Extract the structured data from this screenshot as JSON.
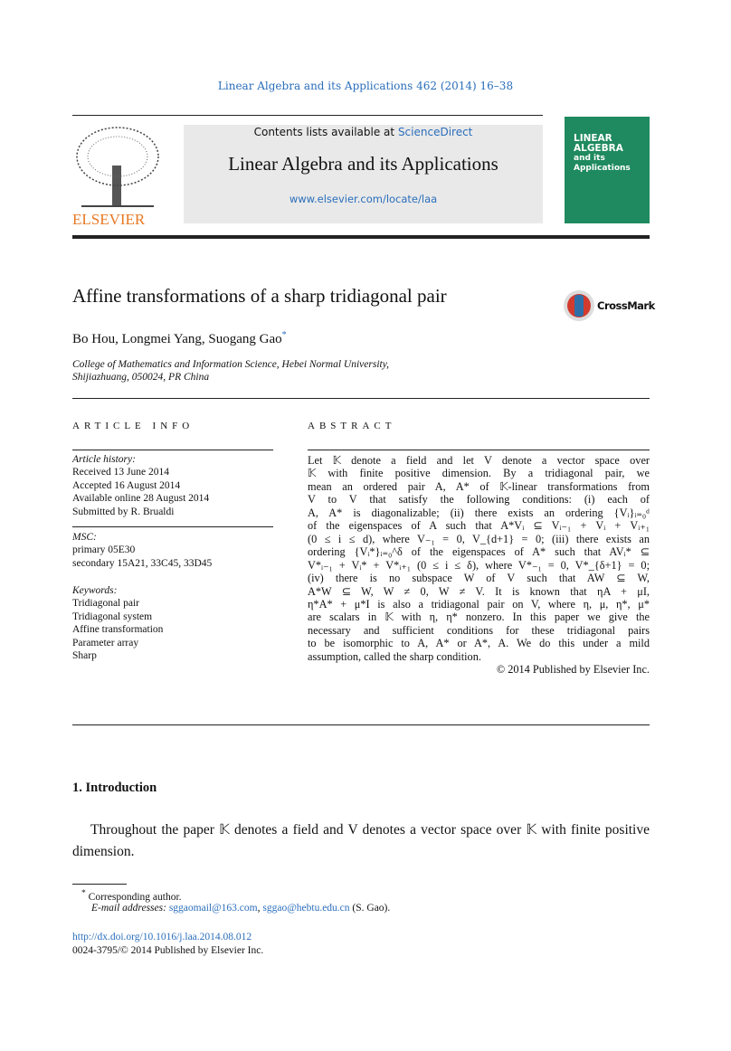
{
  "header": {
    "citation": "Linear Algebra and its Applications 462 (2014) 16–38",
    "contents_prefix": "Contents lists available at ",
    "contents_link": "ScienceDirect",
    "journal_title": "Linear Algebra and its Applications",
    "journal_url": "www.elsevier.com/locate/laa",
    "publisher_logo": "ELSEVIER",
    "cover_title": [
      "LINEAR",
      "ALGEBRA",
      "and its",
      "Applications"
    ]
  },
  "article": {
    "title": "Affine transformations of a sharp tridiagonal pair",
    "crossmark": "CrossMark",
    "authors": "Bo Hou, Longmei Yang, Suogang Gao",
    "author_mark": "*",
    "affiliation": [
      "College of Mathematics and Information Science, Hebei Normal University,",
      "Shijiazhuang, 050024, PR China"
    ]
  },
  "article_info": {
    "heading": "ARTICLE INFO",
    "history_label": "Article history:",
    "history": [
      "Received 13 June 2014",
      "Accepted 16 August 2014",
      "Available online 28 August 2014",
      "Submitted by R. Brualdi"
    ],
    "msc_label": "MSC:",
    "msc": [
      "primary 05E30",
      "secondary 15A21, 33C45, 33D45"
    ],
    "keywords_label": "Keywords:",
    "keywords": [
      "Tridiagonal pair",
      "Tridiagonal system",
      "Affine transformation",
      "Parameter array",
      "Sharp"
    ]
  },
  "abstract": {
    "heading": "ABSTRACT",
    "lines": [
      "Let 𝕂 denote a field and let V denote a vector space over",
      "𝕂 with finite positive dimension. By a tridiagonal pair, we",
      "mean an ordered pair A, A* of 𝕂-linear transformations from",
      "V to V that satisfy the following conditions: (i) each of",
      "A, A* is diagonalizable; (ii) there exists an ordering {Vᵢ}ᵢ₌₀ᵈ",
      "of the eigenspaces of A such that A*Vᵢ ⊆ Vᵢ₋₁ + Vᵢ + Vᵢ₊₁",
      "(0 ≤ i ≤ d), where V₋₁ = 0, V_{d+1} = 0; (iii) there exists an",
      "ordering {Vᵢ*}ᵢ₌₀^δ of the eigenspaces of A* such that AVᵢ* ⊆",
      "V*ᵢ₋₁ + Vᵢ* + V*ᵢ₊₁ (0 ≤ i ≤ δ), where V*₋₁ = 0, V*_{δ+1} = 0;",
      "(iv) there is no subspace W of V such that AW ⊆ W,",
      "A*W ⊆ W, W ≠ 0, W ≠ V. It is known that ηA + μI,",
      "η*A* + μ*I is also a tridiagonal pair on V, where η, μ, η*, μ*",
      "are scalars in 𝕂 with η, η* nonzero. In this paper we give the",
      "necessary and sufficient conditions for these tridiagonal pairs",
      "to be isomorphic to A, A* or A*, A. We do this under a mild",
      "assumption, called the sharp condition."
    ],
    "copyright": "© 2014 Published by Elsevier Inc."
  },
  "intro": {
    "heading": "1.  Introduction",
    "text": "Throughout the paper 𝕂 denotes a field and V denotes a vector space over 𝕂 with finite positive dimension."
  },
  "footnotes": {
    "mark": "*",
    "corresponding": "Corresponding author.",
    "email_label": "E-mail addresses:",
    "email1": "sggaomail@163.com",
    "sep": ", ",
    "email2": "sggao@hebtu.edu.cn",
    "email_suffix": " (S. Gao).",
    "doi": "http://dx.doi.org/10.1016/j.laa.2014.08.012",
    "issn": "0024-3795/© 2014 Published by Elsevier Inc."
  },
  "colors": {
    "link": "#2a6ebb",
    "cover": "#1f8a5f",
    "elsevier_orange": "#e87722"
  }
}
